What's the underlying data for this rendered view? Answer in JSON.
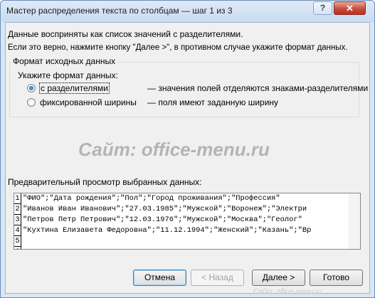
{
  "window": {
    "title": "Мастер распределения текста по столбцам — шаг 1 из 3",
    "help_glyph": "?",
    "close_glyph": "✕"
  },
  "intro": {
    "line1": "Данные восприняты как список значений с разделителями.",
    "line2": "Если это верно, нажмите кнопку \"Далее >\", в противном случае укажите формат данных."
  },
  "source_format": {
    "group_label": "Формат исходных данных",
    "prompt": "Укажите формат данных:",
    "options": [
      {
        "label": "с разделителями",
        "description": "— значения полей отделяются знаками-разделителями",
        "selected": true
      },
      {
        "label": "фиксированной ширины",
        "description": "— поля имеют заданную ширину",
        "selected": false
      }
    ]
  },
  "watermark": "Сайт: office-menu.ru",
  "preview": {
    "label": "Предварительный просмотр выбранных данных:",
    "rows": [
      {
        "num": "1",
        "text": "\"ФИО\";\"Дата рождения\";\"Пол\";\"Город проживания\";\"Профессия\""
      },
      {
        "num": "2",
        "text": "\"Иванов Иван Иванович\";\"27.03.1985\";\"Мужской\";\"Воронеж\";\"Электри"
      },
      {
        "num": "3",
        "text": "\"Петров Петр Петрович\";\"12.03.1976\";\"Мужской\";\"Москва\";\"Геолог\""
      },
      {
        "num": "4",
        "text": "\"Кухтина Елизавета Федоровна\";\"11.12.1994\";\"Женский\";\"Казань\";\"Вр"
      },
      {
        "num": "5",
        "text": ""
      },
      {
        "num": "6",
        "text": ""
      }
    ]
  },
  "buttons": {
    "cancel": "Отмена",
    "back": "< Назад",
    "next": "Далее >",
    "finish": "Готово"
  },
  "footer_watermark": "Сайт: office-menu.ru"
}
